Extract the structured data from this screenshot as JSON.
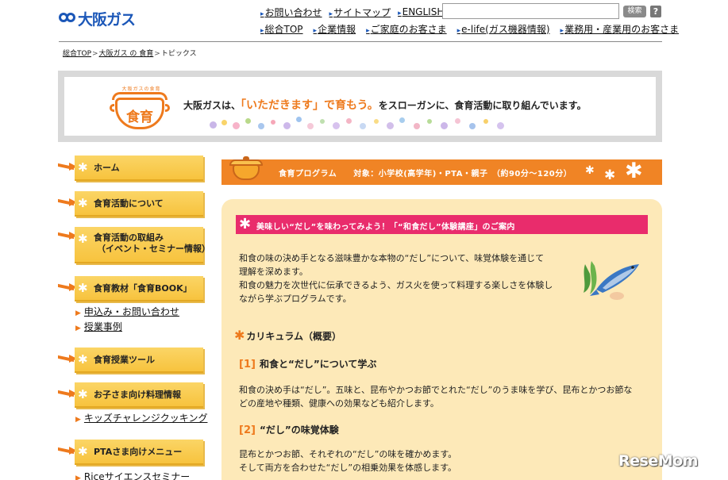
{
  "header": {
    "logo_text": "大阪ガス",
    "util_links": [
      "お問い合わせ",
      "サイトマップ",
      "ENGLISH"
    ],
    "search": {
      "placeholder": "",
      "button_label": "検索"
    },
    "help_label": "?",
    "nav_links": [
      "総合TOP",
      "企業情報",
      "ご家庭のお客さま",
      "e-life(ガス機器情報)",
      "業務用・産業用のお客さま"
    ]
  },
  "breadcrumb": {
    "items": [
      "総合TOP",
      "大阪ガス の 食育"
    ],
    "current": "トピックス",
    "separator": ">"
  },
  "banner": {
    "pot_label": "食育",
    "pot_arc_text": "大阪ガスの食育",
    "slogan_pre": "大阪ガスは、",
    "slogan_highlight": "「いただきます」で育もう。",
    "slogan_post": "をスローガンに、食育活動に取り組んでいます。"
  },
  "sidebar": {
    "items": [
      {
        "label": "ホーム"
      },
      {
        "label": "食育活動について"
      },
      {
        "label_line1": "食育活動の取組み",
        "label_line2": "（イベント・セミナー情報）"
      },
      {
        "label": "食育教材「食育BOOK」"
      },
      {
        "label": "食育授業ツール"
      },
      {
        "label": "お子さま向け料理情報"
      },
      {
        "label": "PTAさま向けメニュー"
      }
    ],
    "sub_links": {
      "book": [
        "申込み・お問い合わせ",
        "授業事例"
      ],
      "kids": [
        "キッズチャレンジクッキング"
      ],
      "pta": [
        "Riceサイエンスセミナー"
      ]
    }
  },
  "program_bar": {
    "text": "食育プログラム　　対象：小学校(高学年)・PTA・親子　（約90分～120分）"
  },
  "content": {
    "title": "美味しい“だし”を味わってみよう！「“和食だし”体験講座」のご案内",
    "intro": [
      "和食の味の決め手となる滋味豊かな本物の“だし”について、味覚体験を通じて",
      "理解を深めます。",
      "和食の魅力を次世代に伝承できるよう、ガス火を使って料理する楽しさを体験し",
      "ながら学ぶプログラムです。"
    ],
    "curriculum_heading": "カリキュラム（概要）",
    "sections": [
      {
        "num": "[1]",
        "title": "和食と“だし”について学ぶ",
        "body": [
          "和食の決め手は“だし”。五味と、昆布やかつお節でとれた“だし”のうま味を学び、昆布とかつお節な",
          "どの産地や種類、健康への効果なども紹介します。"
        ]
      },
      {
        "num": "[2]",
        "title": "“だし”の味覚体験",
        "body": [
          "昆布とかつお節、それぞれの“だし”の味を確かめます。",
          "そして両方を合わせた“だし”の相乗効果を体感します。"
        ]
      }
    ]
  },
  "watermark": "ReseMom",
  "colors": {
    "brand_blue": "#1b57b8",
    "accent_orange": "#f08425",
    "sidebar_yellow": "#f7c33e",
    "content_cream": "#fde9b8",
    "title_pink": "#e92c6c"
  }
}
